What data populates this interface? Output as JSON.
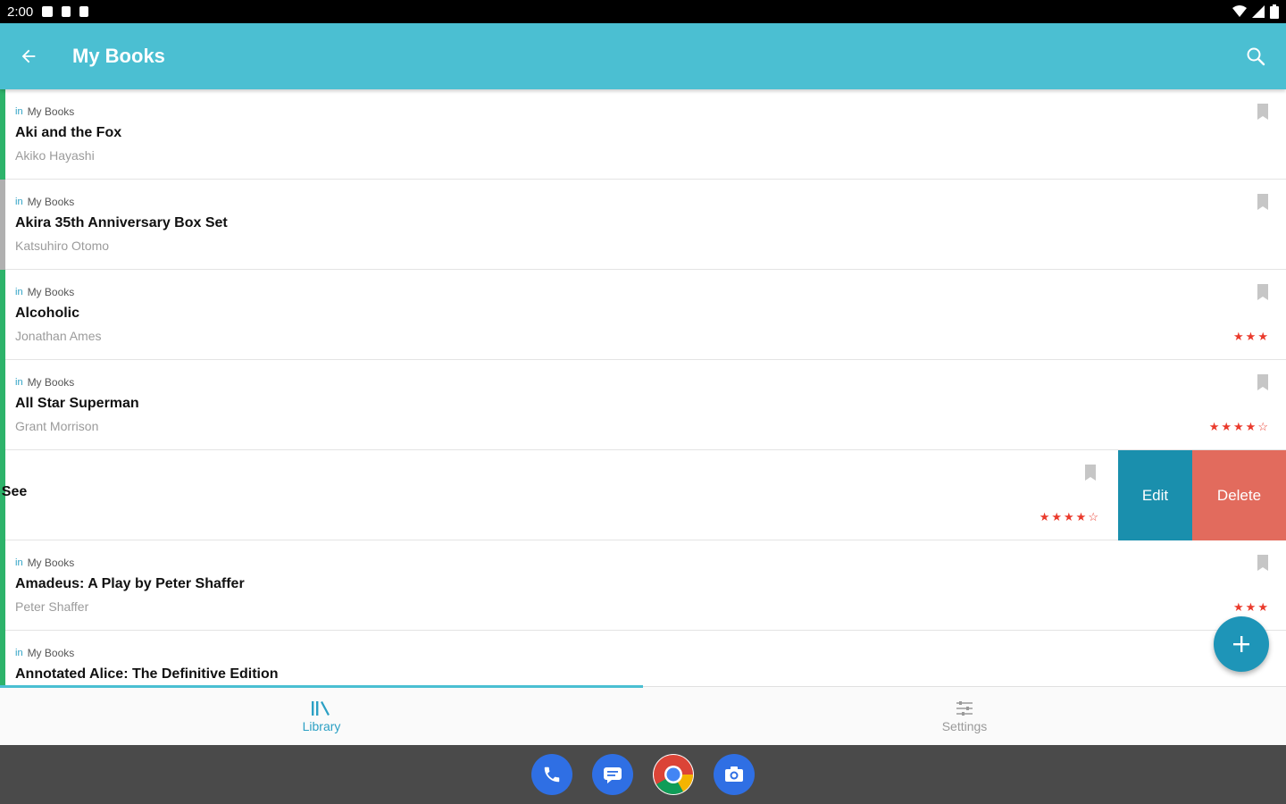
{
  "status_bar": {
    "time": "2:00"
  },
  "app_bar": {
    "title": "My Books",
    "back_icon": "arrow-left-icon",
    "search_icon": "search-icon"
  },
  "colors": {
    "accent": "#4bbfd2",
    "edit": "#1a8fad",
    "delete": "#e26b5d",
    "star": "#ea3a2c"
  },
  "books": [
    {
      "shelf_prefix": "in",
      "shelf": "My Books",
      "title": "Aki and the Fox",
      "author": "Akiko Hayashi",
      "rating": 0,
      "edge_color": "#2db36a"
    },
    {
      "shelf_prefix": "in",
      "shelf": "My Books",
      "title": "Akira 35th Anniversary Box Set",
      "author": "Katsuhiro Otomo",
      "rating": 0,
      "edge_color": "#b0b0b0"
    },
    {
      "shelf_prefix": "in",
      "shelf": "My Books",
      "title": "Alcoholic",
      "author": "Jonathan Ames",
      "rating": 3,
      "stars_text": "★★★",
      "edge_color": "#2db36a"
    },
    {
      "shelf_prefix": "in",
      "shelf": "My Books",
      "title": "All Star Superman",
      "author": "Grant Morrison",
      "rating": 4.5,
      "stars_text": "★★★★☆",
      "edge_color": "#2db36a"
    },
    {
      "title": "t See",
      "rating": 4.5,
      "stars_text": "★★★★☆",
      "edge_color": "#2db36a",
      "swiped": true
    },
    {
      "shelf_prefix": "in",
      "shelf": "My Books",
      "title": "Amadeus: A Play by Peter Shaffer",
      "author": "Peter Shaffer",
      "rating": 3,
      "stars_text": "★★★",
      "edge_color": "#2db36a"
    },
    {
      "shelf_prefix": "in",
      "shelf": "My Books",
      "title": "Annotated Alice: The Definitive Edition",
      "edge_color": "#2db36a"
    }
  ],
  "swipe_actions": {
    "edit_label": "Edit",
    "delete_label": "Delete"
  },
  "fab": {
    "icon": "plus-icon"
  },
  "bottom_nav": {
    "tabs": [
      {
        "label": "Library",
        "icon": "library-icon",
        "active": true
      },
      {
        "label": "Settings",
        "icon": "sliders-icon",
        "active": false
      }
    ]
  },
  "dock": [
    {
      "name": "phone",
      "icon": "phone-icon",
      "color": "#2f6fe4"
    },
    {
      "name": "messages",
      "icon": "message-icon",
      "color": "#2f6fe4"
    },
    {
      "name": "chrome",
      "icon": "chrome-icon",
      "color": "#ffffff"
    },
    {
      "name": "camera",
      "icon": "camera-icon",
      "color": "#2f6fe4"
    }
  ]
}
